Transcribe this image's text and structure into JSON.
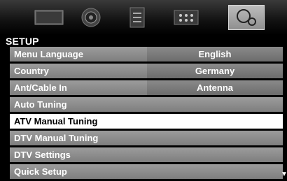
{
  "section_title": "SETUP",
  "tabs": [
    {
      "icon": "picture-icon",
      "selected": false
    },
    {
      "icon": "sound-icon",
      "selected": false
    },
    {
      "icon": "channel-list-icon",
      "selected": false
    },
    {
      "icon": "apps-icon",
      "selected": false
    },
    {
      "icon": "setup-icon",
      "selected": true
    }
  ],
  "menu": {
    "items": [
      {
        "label": "Menu Language",
        "value": "English"
      },
      {
        "label": "Country",
        "value": "Germany"
      },
      {
        "label": "Ant/Cable In",
        "value": "Antenna"
      },
      {
        "label": "Auto Tuning",
        "value": ""
      },
      {
        "label": "ATV Manual Tuning",
        "value": ""
      },
      {
        "label": "DTV Manual Tuning",
        "value": ""
      },
      {
        "label": "DTV Settings",
        "value": ""
      },
      {
        "label": "Quick Setup",
        "value": ""
      }
    ],
    "selected_index": 4
  },
  "scroll_indicator": "▼",
  "colors": {
    "row": "#8e8e8e",
    "selected_row": "#ffffff",
    "background": "#000000"
  }
}
